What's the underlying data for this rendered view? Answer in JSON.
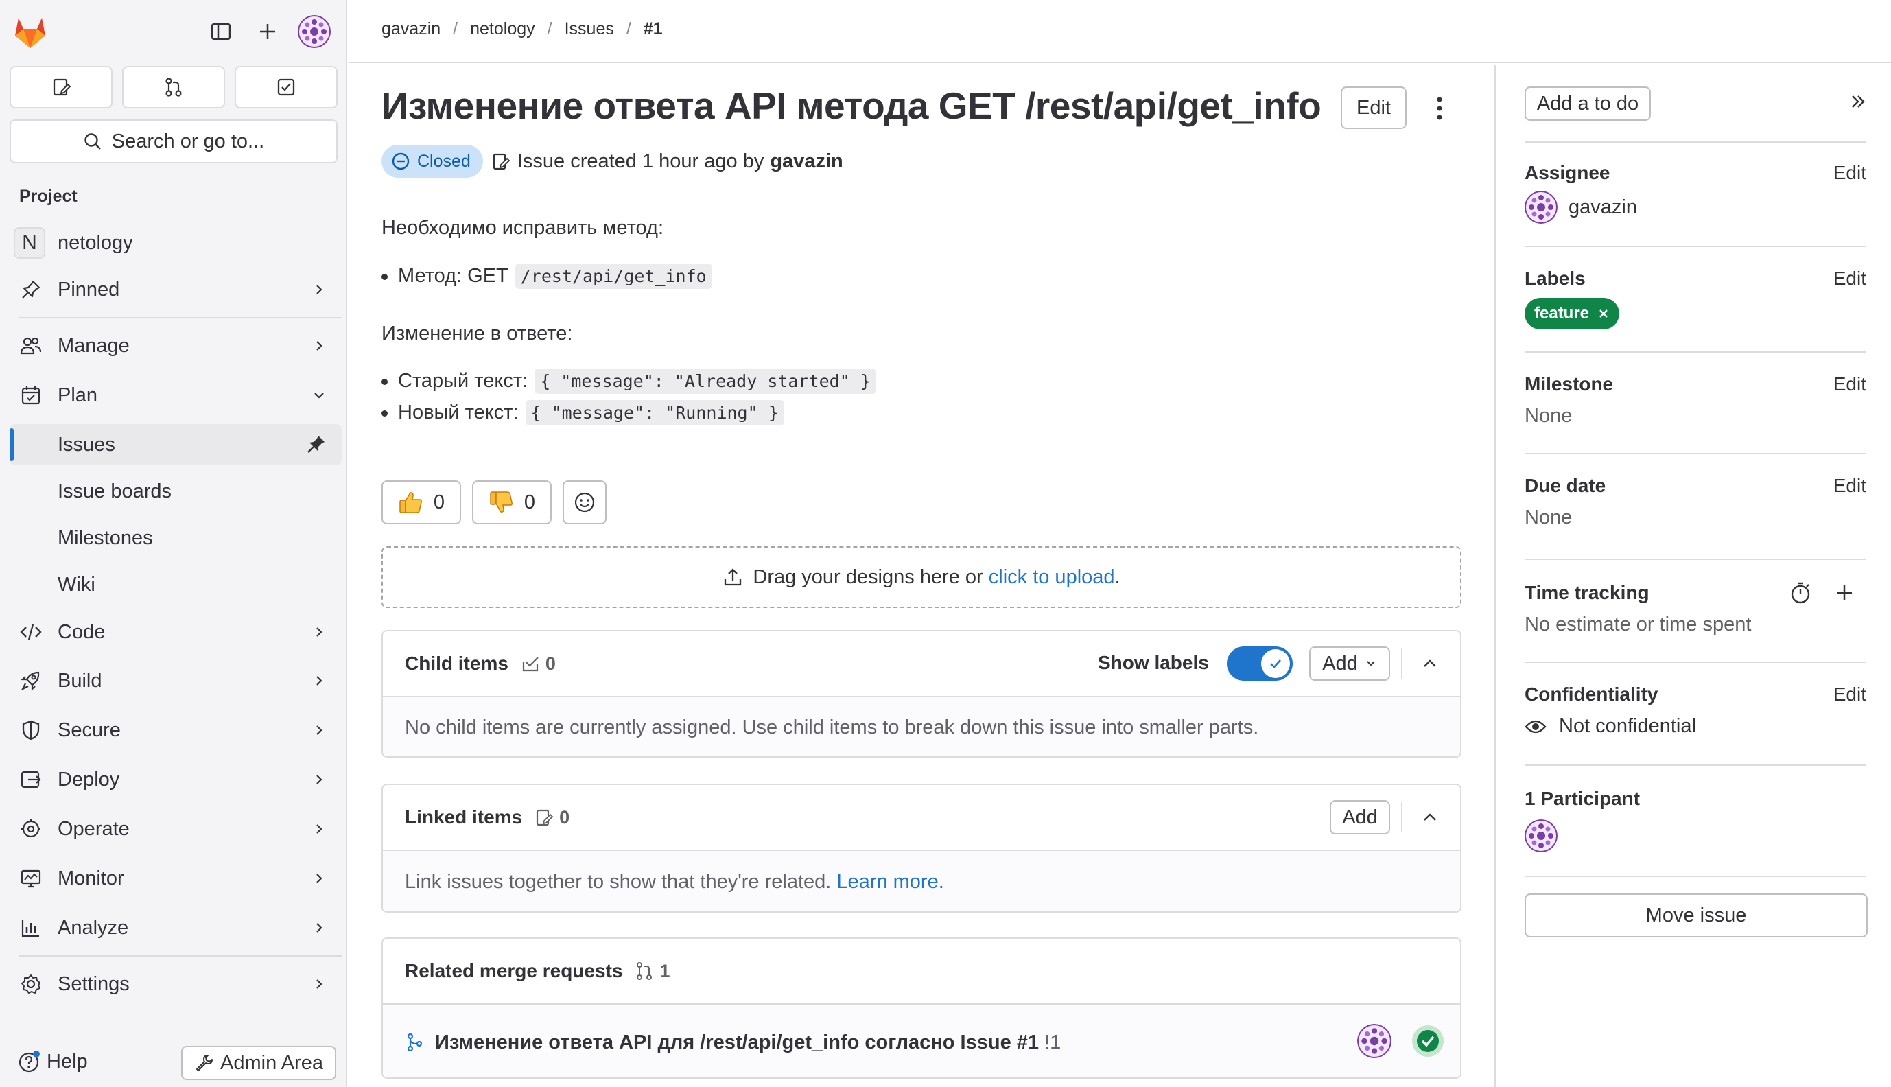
{
  "sidebar": {
    "search_label": "Search or go to...",
    "section_title": "Project",
    "project_initial": "N",
    "project_name": "netology",
    "nav": {
      "pinned": "Pinned",
      "manage": "Manage",
      "plan": "Plan",
      "issues": "Issues",
      "issue_boards": "Issue boards",
      "milestones": "Milestones",
      "wiki": "Wiki",
      "code": "Code",
      "build": "Build",
      "secure": "Secure",
      "deploy": "Deploy",
      "operate": "Operate",
      "monitor": "Monitor",
      "analyze": "Analyze",
      "settings": "Settings"
    },
    "help": "Help",
    "admin_area": "Admin Area"
  },
  "breadcrumbs": {
    "user": "gavazin",
    "project": "netology",
    "issues": "Issues",
    "current": "#1",
    "sep": "/"
  },
  "issue": {
    "title": "Изменение ответа API метода GET /rest/api/get_info",
    "edit_label": "Edit",
    "status": "Closed",
    "created_text": "Issue created 1 hour ago by",
    "author": "gavazin",
    "description": {
      "intro": "Необходимо исправить метод:",
      "method_label": "Метод: GET",
      "method_code": "/rest/api/get_info",
      "change_heading": "Изменение в ответе:",
      "old_label": "Старый текст:",
      "old_code": "{ \"message\": \"Already started\" }",
      "new_label": "Новый текст:",
      "new_code": "{ \"message\": \"Running\" }"
    },
    "reactions": {
      "thumbs_up": "0",
      "thumbs_down": "0"
    },
    "dropzone": {
      "text": "Drag your designs here or",
      "link": "click to upload",
      "tail": "."
    }
  },
  "child_items": {
    "title": "Child items",
    "count": "0",
    "show_labels": "Show labels",
    "add": "Add",
    "empty": "No child items are currently assigned. Use child items to break down this issue into smaller parts."
  },
  "linked_items": {
    "title": "Linked items",
    "count": "0",
    "add": "Add",
    "empty": "Link issues together to show that they're related.",
    "learn_more": "Learn more."
  },
  "related_mrs": {
    "title": "Related merge requests",
    "count": "1",
    "mr_title": "Изменение ответа API для /rest/api/get_info согласно Issue #1",
    "mr_ref": "!1"
  },
  "right_sidebar": {
    "add_todo": "Add a to do",
    "assignee": {
      "title": "Assignee",
      "edit": "Edit",
      "value": "gavazin"
    },
    "labels": {
      "title": "Labels",
      "edit": "Edit",
      "label": "feature"
    },
    "milestone": {
      "title": "Milestone",
      "edit": "Edit",
      "value": "None"
    },
    "due_date": {
      "title": "Due date",
      "edit": "Edit",
      "value": "None"
    },
    "time_tracking": {
      "title": "Time tracking",
      "value": "No estimate or time spent"
    },
    "confidentiality": {
      "title": "Confidentiality",
      "edit": "Edit",
      "value": "Not confidential"
    },
    "participants": {
      "title": "1 Participant"
    },
    "move_issue": "Move issue"
  },
  "colors": {
    "accent": "#1f75cb",
    "label_green": "#108548",
    "closed_badge_bg": "#cbe2f9",
    "avatar_purple": "#7b3fa3"
  }
}
